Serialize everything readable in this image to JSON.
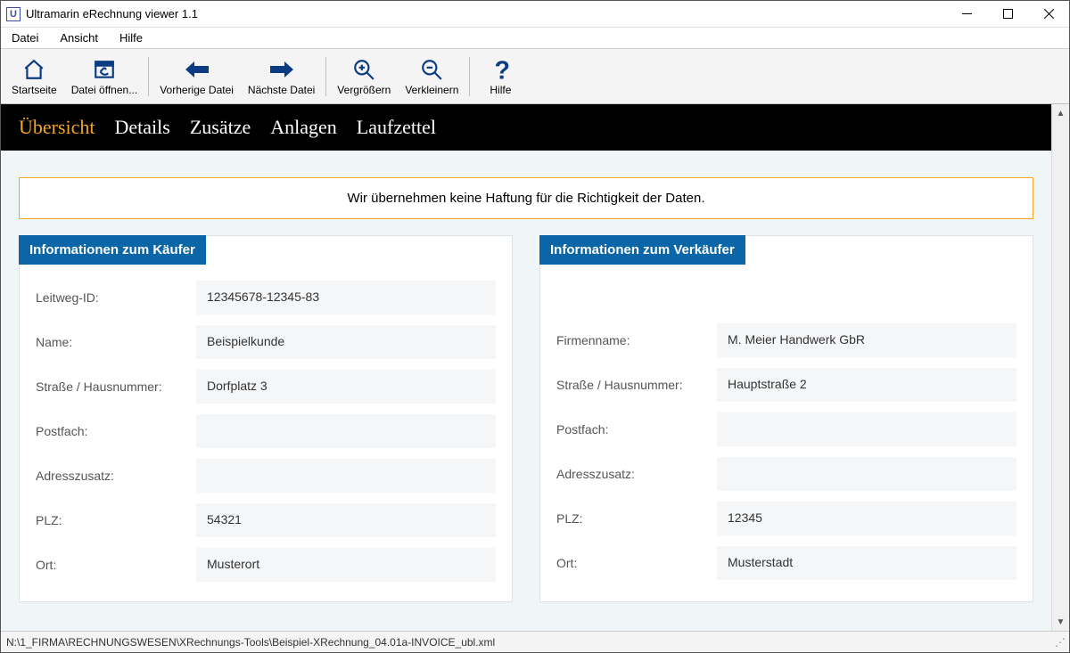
{
  "window": {
    "title": "Ultramarin eRechnung viewer 1.1"
  },
  "menubar": {
    "file": "Datei",
    "view": "Ansicht",
    "help": "Hilfe"
  },
  "toolbar": {
    "home": "Startseite",
    "open": "Datei öffnen...",
    "prev": "Vorherige Datei",
    "next": "Nächste Datei",
    "zoomin": "Vergrößern",
    "zoomout": "Verkleinern",
    "help": "Hilfe"
  },
  "doc_tabs": {
    "overview": "Übersicht",
    "details": "Details",
    "extras": "Zusätze",
    "attachments": "Anlagen",
    "routing": "Laufzettel"
  },
  "notice": "Wir übernehmen keine Haftung für die Richtigkeit der Daten.",
  "buyer": {
    "title": "Informationen zum Käufer",
    "leitweg_label": "Leitweg-ID:",
    "leitweg_value": "12345678-12345-83",
    "name_label": "Name:",
    "name_value": "Beispielkunde",
    "street_label": "Straße / Hausnummer:",
    "street_value": "Dorfplatz 3",
    "pobox_label": "Postfach:",
    "pobox_value": "",
    "addr2_label": "Adresszusatz:",
    "addr2_value": "",
    "zip_label": "PLZ:",
    "zip_value": "54321",
    "city_label": "Ort:",
    "city_value": "Musterort"
  },
  "seller": {
    "title": "Informationen zum Verkäufer",
    "name_label": "Firmenname:",
    "name_value": "M. Meier Handwerk GbR",
    "street_label": "Straße / Hausnummer:",
    "street_value": "Hauptstraße 2",
    "pobox_label": "Postfach:",
    "pobox_value": "",
    "addr2_label": "Adresszusatz:",
    "addr2_value": "",
    "zip_label": "PLZ:",
    "zip_value": "12345",
    "city_label": "Ort:",
    "city_value": "Musterstadt"
  },
  "status": {
    "path": "N:\\1_FIRMA\\RECHNUNGSWESEN\\XRechnungs-Tools\\Beispiel-XRechnung_04.01a-INVOICE_ubl.xml"
  }
}
